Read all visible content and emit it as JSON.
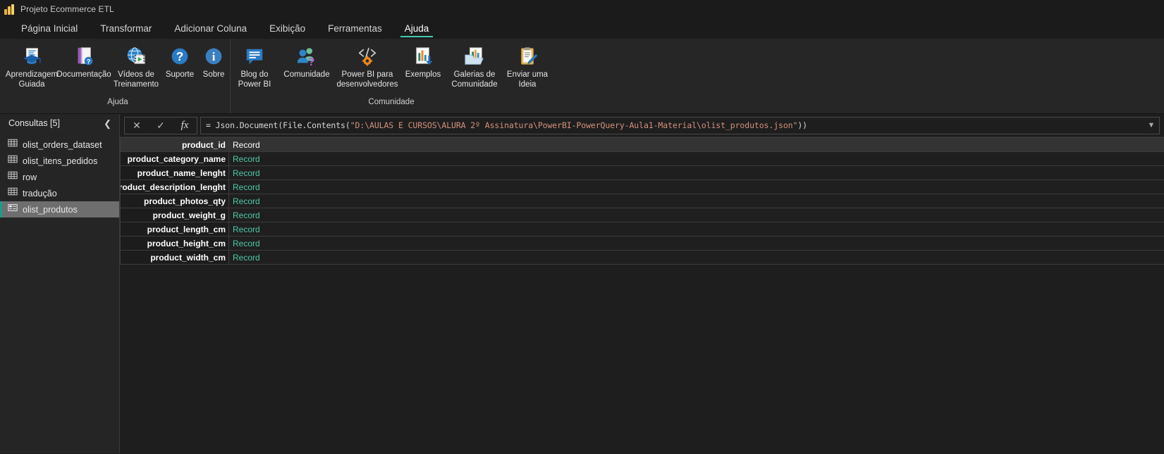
{
  "titlebar": {
    "app_title": "Projeto Ecommerce ETL",
    "logo_icon": "powerbi-logo-icon"
  },
  "tabs": [
    {
      "label": "Página Inicial",
      "active": false
    },
    {
      "label": "Transformar",
      "active": false
    },
    {
      "label": "Adicionar Coluna",
      "active": false
    },
    {
      "label": "Exibição",
      "active": false
    },
    {
      "label": "Ferramentas",
      "active": false
    },
    {
      "label": "Ajuda",
      "active": true
    }
  ],
  "ribbon": {
    "groups": [
      {
        "label": "Ajuda",
        "buttons": [
          {
            "label": "Aprendizagem\nGuiada",
            "icon": "guided-learning-icon"
          },
          {
            "label": "Documentação",
            "icon": "documentation-book-icon"
          },
          {
            "label": "Vídeos de\nTreinamento",
            "icon": "training-videos-globe-icon"
          },
          {
            "label": "Suporte",
            "icon": "support-question-icon"
          },
          {
            "label": "Sobre",
            "icon": "about-info-icon"
          }
        ]
      },
      {
        "label": "Comunidade",
        "buttons": [
          {
            "label": "Blog do\nPower BI",
            "icon": "blog-speech-bubble-icon"
          },
          {
            "label": "Comunidade",
            "icon": "community-people-icon"
          },
          {
            "label": "Power BI para\ndesenvolvedores",
            "icon": "developers-code-gear-icon"
          },
          {
            "label": "Exemplos",
            "icon": "samples-download-icon"
          },
          {
            "label": "Galerias de\nComunidade",
            "icon": "gallery-folder-icon"
          },
          {
            "label": "Enviar uma\nIdeia",
            "icon": "submit-idea-clipboard-icon"
          }
        ]
      }
    ]
  },
  "sidebar": {
    "title": "Consultas [5]",
    "collapse_icon": "chevron-left-icon",
    "queries": [
      {
        "label": "olist_orders_dataset",
        "icon": "table-icon",
        "selected": false
      },
      {
        "label": "olist_itens_pedidos",
        "icon": "table-icon",
        "selected": false
      },
      {
        "label": "row",
        "icon": "table-icon",
        "selected": false
      },
      {
        "label": "tradução",
        "icon": "table-icon",
        "selected": false
      },
      {
        "label": "olist_produtos",
        "icon": "record-icon",
        "selected": true
      }
    ]
  },
  "formula_bar": {
    "cancel_icon": "cancel-x-icon",
    "confirm_icon": "confirm-check-icon",
    "fx_icon": "fx-icon",
    "expand_icon": "chevron-down-icon",
    "prefix": "= Json.Document(File.Contents(",
    "path_literal": "\"D:\\AULAS E CURSOS\\ALURA 2º Assinatura\\PowerBI-PowerQuery-Aula1-Material\\olist_produtos.json\"",
    "suffix": "))",
    "full_text": "= Json.Document(File.Contents(\"D:\\AULAS E CURSOS\\ALURA 2º Assinatura\\PowerBI-PowerQuery-Aula1-Material\\olist_produtos.json\"))"
  },
  "grid": {
    "rows": [
      {
        "name": "product_id",
        "value": "Record",
        "selected": true
      },
      {
        "name": "product_category_name",
        "value": "Record",
        "selected": false
      },
      {
        "name": "product_name_lenght",
        "value": "Record",
        "selected": false
      },
      {
        "name": "product_description_lenght",
        "value": "Record",
        "selected": false
      },
      {
        "name": "product_photos_qty",
        "value": "Record",
        "selected": false
      },
      {
        "name": "product_weight_g",
        "value": "Record",
        "selected": false
      },
      {
        "name": "product_length_cm",
        "value": "Record",
        "selected": false
      },
      {
        "name": "product_height_cm",
        "value": "Record",
        "selected": false
      },
      {
        "name": "product_width_cm",
        "value": "Record",
        "selected": false
      }
    ]
  },
  "colors": {
    "accent_teal": "#45c9b0",
    "record_value": "#4ec9a8",
    "string_literal": "#d3927c",
    "selection_bg": "#6e6e6e"
  }
}
